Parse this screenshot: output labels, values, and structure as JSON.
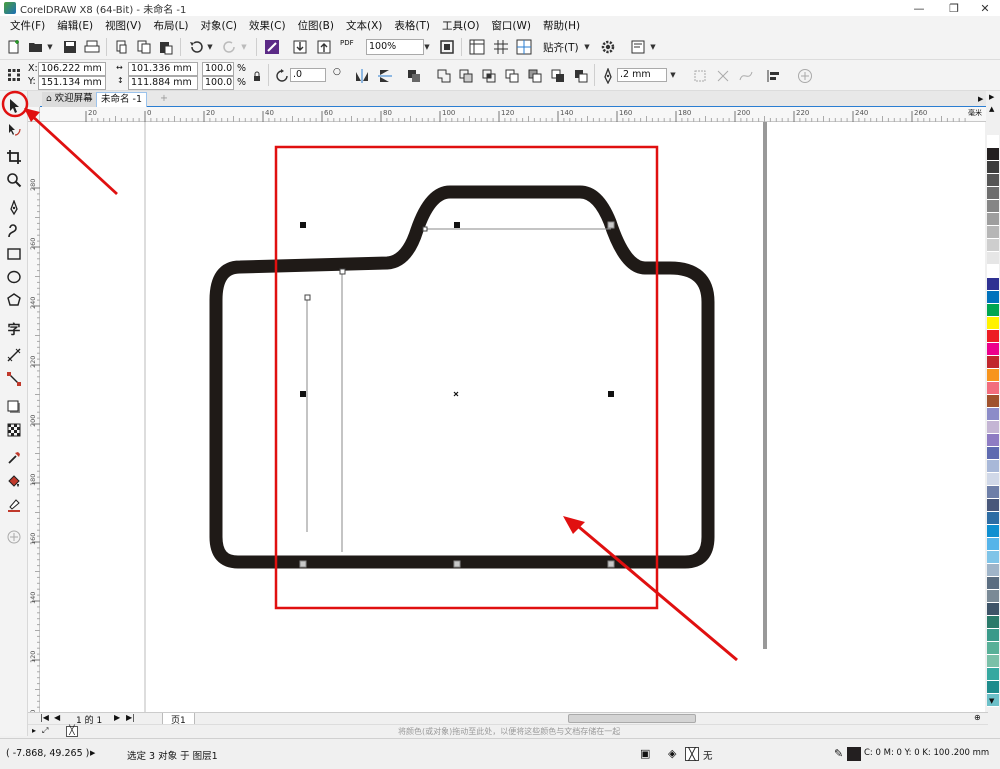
{
  "window": {
    "title": "CorelDRAW X8 (64-Bit) - 未命名 -1",
    "min": "—",
    "restore": "❐",
    "close": "✕"
  },
  "menu": [
    "文件(F)",
    "编辑(E)",
    "视图(V)",
    "布局(L)",
    "对象(C)",
    "效果(C)",
    "位图(B)",
    "文本(X)",
    "表格(T)",
    "工具(O)",
    "窗口(W)",
    "帮助(H)"
  ],
  "toolbar": {
    "zoom": "100%",
    "snap_label": "贴齐(T)",
    "pdf_label": "PDF"
  },
  "propbar": {
    "x_label": "X:",
    "x": "106.222 mm",
    "y_label": "Y:",
    "y": "151.134 mm",
    "w": "101.336 mm",
    "h": "111.884 mm",
    "sx": "100.0",
    "sy": "100.0",
    "pct": "%",
    "angle": ".0",
    "outline": ".2 mm"
  },
  "tabs": {
    "welcome": "欢迎屏幕",
    "doc": "未命名 -1"
  },
  "ruler": {
    "h_ticks": [
      "20",
      "0",
      "20",
      "40",
      "60",
      "80",
      "100",
      "120",
      "140",
      "160",
      "180",
      "200",
      "220",
      "240",
      "260"
    ],
    "unit": "毫米",
    "v_ticks": [
      "280",
      "260",
      "240",
      "220",
      "200",
      "180",
      "160",
      "140",
      "120",
      "100",
      "80"
    ]
  },
  "docnav": {
    "page_of": "1 的 1",
    "page_tab": "页1"
  },
  "hint": "将颜色(或对象)拖动至此处，以便将这些颜色与文档存储在一起",
  "status": {
    "coords": "( -7.868, 49.265 )",
    "selection": "选定 3 对象 于 图层1",
    "fill_none": "无",
    "outline_color": "C: 0 M: 0 Y: 0 K: 100",
    "outline_width": ".200 mm"
  },
  "colors": {
    "accent": "#2a7dd1",
    "annotation_red": "#e01010",
    "shape_stroke": "#1f1a17"
  },
  "palette": [
    "#ffffff",
    "#231f20",
    "#3c3c3c",
    "#555555",
    "#6d6d6d",
    "#858585",
    "#9e9e9e",
    "#b6b6b6",
    "#cecece",
    "#e6e6e6",
    "#ffffff",
    "#2e3192",
    "#0072bc",
    "#00a651",
    "#fff200",
    "#ed1c24",
    "#ec008c",
    "#c1272d",
    "#f7941d",
    "#f26d7d",
    "#a0522d",
    "#8c8cc8",
    "#c4b5d4",
    "#8e7cc3",
    "#5e6ab0",
    "#a8b8d8",
    "#d0d8e8",
    "#6e7fa8",
    "#48577a",
    "#2e6da4",
    "#0f8fd0",
    "#56b4e9",
    "#7fc4e8",
    "#9fb4c8",
    "#5a6d80",
    "#7a8a96",
    "#3e5468",
    "#2a7a6a",
    "#3a9a8a",
    "#58b098",
    "#7ac0a8",
    "#36a8a0",
    "#1e8c8c",
    "#6cc0c8"
  ]
}
